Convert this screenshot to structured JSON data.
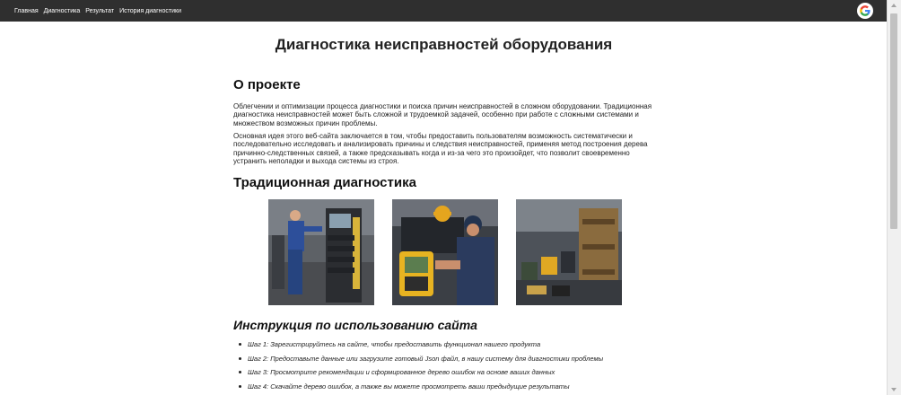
{
  "nav": {
    "items": [
      "Главная",
      "Диагностика",
      "Результат",
      "История диагностики"
    ]
  },
  "login": {
    "icon": "google-icon"
  },
  "page": {
    "title": "Диагностика неисправностей оборудования",
    "about": {
      "heading": "О проекте",
      "para1": "Облегчении и оптимизации процесса диагностики и поиска причин неисправностей в сложном оборудовании. Традиционная диагностика неисправностей может быть сложной и трудоемкой задачей, особенно при работе с сложными системами и множеством возможных причин проблемы.",
      "para2": "Основная идея этого веб-сайта заключается в том, чтобы предоставить пользователям возможность систематически и последовательно исследовать и анализировать причины и следствия неисправностей, применяя метод построения дерева причинно-следственных связей, а также предсказывать когда и из-за чего это произойдет, что позволит своевременно устранить неполадки и выхода системы из строя."
    },
    "traditional": {
      "heading": "Традиционная диагностика"
    },
    "instructions": {
      "heading": "Инструкция по использованию сайта",
      "steps": [
        "Шаг 1: Зарегистрируйтесь на сайте, чтобы предоставить функционал нашего продукта",
        "Шаг 2: Предоставьте данные или загрузите готовый Json файл, в нашу систему для диагностики проблемы",
        "Шаг 3: Просмотрите рекомендации и сформированное дерево ошибок на основе ваших данных",
        "Шаг 4: Скачайте дерево ошибок, а также вы можете просмотреть ваши предыдущие результаты"
      ]
    }
  },
  "colors": {
    "topbar": "#2f2f2f",
    "page_bg": "#ffffff",
    "outer_bg": "#e9e9e9"
  }
}
